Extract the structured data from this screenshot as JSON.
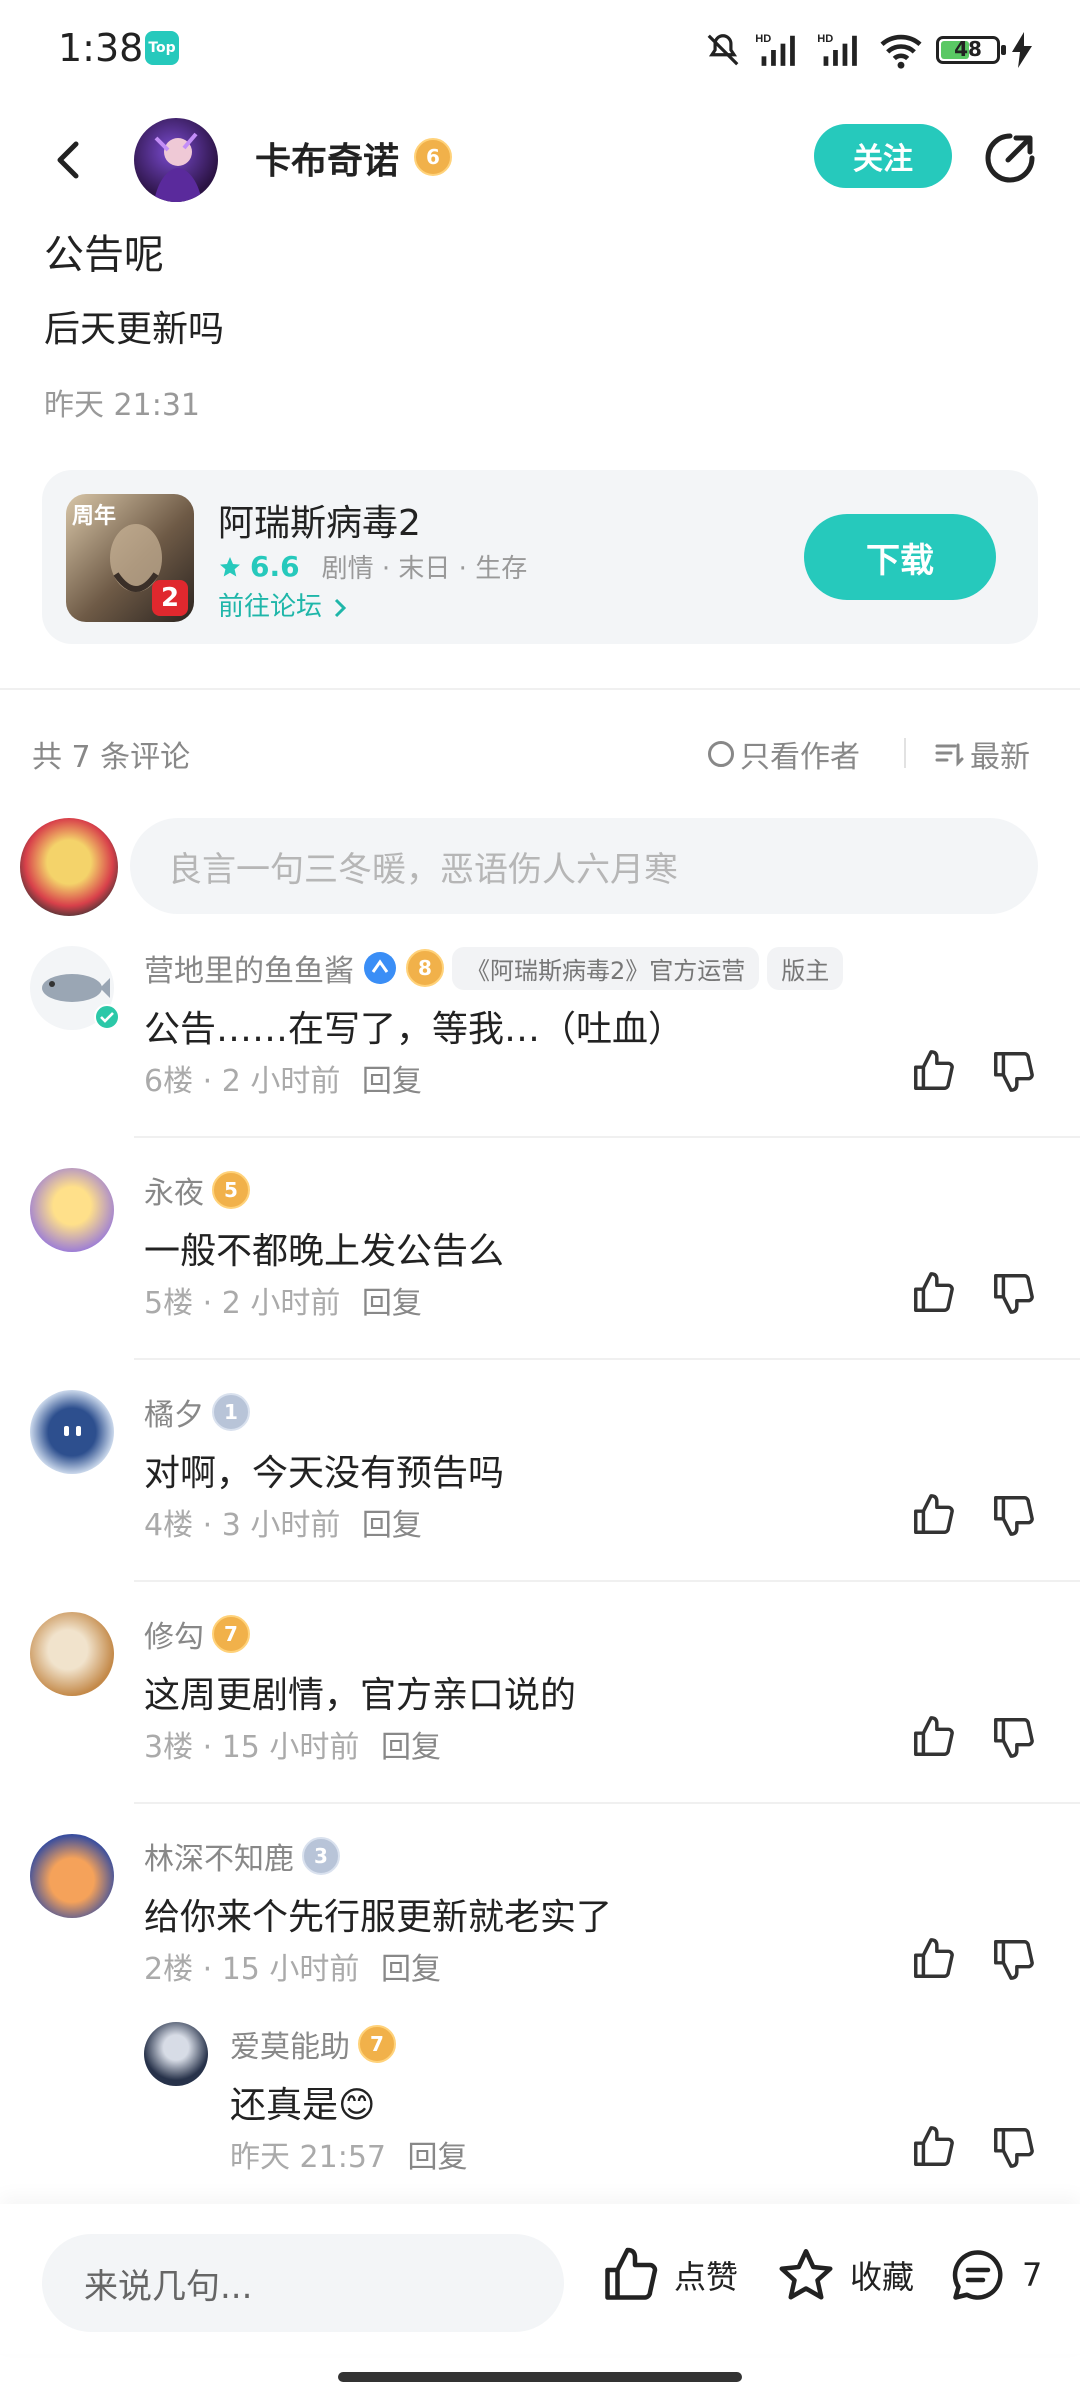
{
  "status_bar": {
    "time": "1:38",
    "app_icon_label": "Top",
    "battery_level": "48",
    "icons": [
      "mute-icon",
      "signal-hd-icon",
      "signal-hd-icon",
      "wifi-icon",
      "battery-icon",
      "charging-icon"
    ]
  },
  "header": {
    "author_name": "卡布奇诺",
    "author_level": "6",
    "follow_label": "关注"
  },
  "post": {
    "title": "公告呢",
    "body": "后天更新吗",
    "time": "昨天 21:31"
  },
  "game": {
    "name": "阿瑞斯病毒2",
    "rating": "6.6",
    "tags": "剧情 · 末日 · 生存",
    "forum_link": "前往论坛",
    "download_label": "下载",
    "icon_anniversary": "周年",
    "icon_number": "2"
  },
  "comments_header": {
    "count": "共 7 条评论",
    "author_only": "只看作者",
    "sort": "最新"
  },
  "comment_input_placeholder": "良言一句三冬暖，恶语伤人六月寒",
  "comments": [
    {
      "name": "营地里的鱼鱼酱",
      "level": "8",
      "tag1": "《阿瑞斯病毒2》官方运营",
      "tag2": "版主",
      "text": "公告……在写了，等我…（吐血）",
      "floor": "6楼",
      "time": "2 小时前",
      "reply": "回复"
    },
    {
      "name": "永夜",
      "level": "5",
      "text": "一般不都晚上发公告么",
      "floor": "5楼",
      "time": "2 小时前",
      "reply": "回复"
    },
    {
      "name": "橘夕",
      "level": "1",
      "text": "对啊，今天没有预告吗",
      "floor": "4楼",
      "time": "3 小时前",
      "reply": "回复"
    },
    {
      "name": "修勾",
      "level": "7",
      "text": "这周更剧情，官方亲口说的",
      "floor": "3楼",
      "time": "15 小时前",
      "reply": "回复"
    },
    {
      "name": "林深不知鹿",
      "level": "3",
      "text": "给你来个先行服更新就老实了",
      "floor": "2楼",
      "time": "15 小时前",
      "reply": "回复"
    }
  ],
  "sub_reply": {
    "name": "爱莫能助",
    "level": "7",
    "text": "还真是😊",
    "time": "昨天 21:57",
    "reply": "回复"
  },
  "bottom_bar": {
    "input_placeholder": "来说几句...",
    "like_label": "点赞",
    "favorite_label": "收藏",
    "comment_count": "7"
  }
}
